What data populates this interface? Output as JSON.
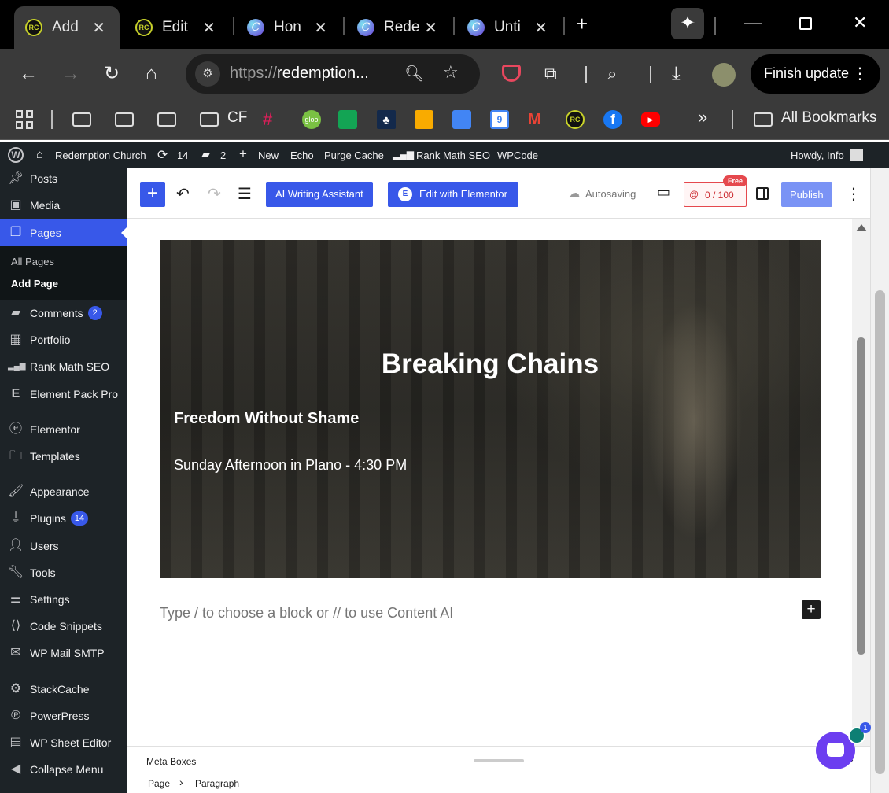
{
  "browser": {
    "tabs": [
      {
        "title": "Add",
        "favicon": "rc-logo",
        "active": true
      },
      {
        "title": "Edit",
        "favicon": "rc-logo"
      },
      {
        "title": "Hon",
        "favicon": "canva-logo"
      },
      {
        "title": "Rede",
        "favicon": "canva-logo"
      },
      {
        "title": "Unti",
        "favicon": "canva-logo"
      }
    ],
    "url_scheme": "https://",
    "url_host": "redemption...",
    "finish_update": "Finish update",
    "bookmarks": {
      "cf_label": "CF",
      "gloo_label": "gloo",
      "calendar_day": "9",
      "all_bookmarks": "All Bookmarks",
      "overflow": "»"
    }
  },
  "adminbar": {
    "site_name": "Redemption Church",
    "updates_count": "14",
    "comments_count": "2",
    "new_label": "New",
    "echo": "Echo",
    "purge_cache": "Purge Cache",
    "rank_math": "Rank Math SEO",
    "wpcode": "WPCode",
    "howdy": "Howdy, Info"
  },
  "sidebar": {
    "posts": "Posts",
    "media": "Media",
    "pages": "Pages",
    "all_pages": "All Pages",
    "add_page": "Add Page",
    "comments": "Comments",
    "comments_badge": "2",
    "portfolio": "Portfolio",
    "rank_math": "Rank Math SEO",
    "element_pack": "Element Pack Pro",
    "elementor": "Elementor",
    "templates": "Templates",
    "appearance": "Appearance",
    "plugins": "Plugins",
    "plugins_badge": "14",
    "users": "Users",
    "tools": "Tools",
    "settings": "Settings",
    "code_snippets": "Code Snippets",
    "wp_mail_smtp": "WP Mail SMTP",
    "stackcache": "StackCache",
    "powerpress": "PowerPress",
    "wp_sheet_editor": "WP Sheet Editor",
    "collapse": "Collapse Menu"
  },
  "editor": {
    "ai_assistant": "AI Writing Assistant",
    "edit_elementor": "Edit with Elementor",
    "autosaving": "Autosaving",
    "content_ai_count": "0 / 100",
    "free_tag": "Free",
    "publish": "Publish"
  },
  "content": {
    "cover_title": "Breaking Chains",
    "cover_subtitle": "Freedom Without Shame",
    "cover_time": "Sunday Afternoon in Plano - 4:30 PM",
    "placeholder": "Type / to choose a block or // to use Content AI"
  },
  "footer": {
    "meta_boxes": "Meta Boxes",
    "breadcrumb_page": "Page",
    "breadcrumb_sep": "›",
    "breadcrumb_block": "Paragraph",
    "chat_badge": "1"
  },
  "colors": {
    "wp_accent": "#3858e9",
    "admin_dark": "#1d2327",
    "browser_chrome": "#3a3a3a"
  }
}
